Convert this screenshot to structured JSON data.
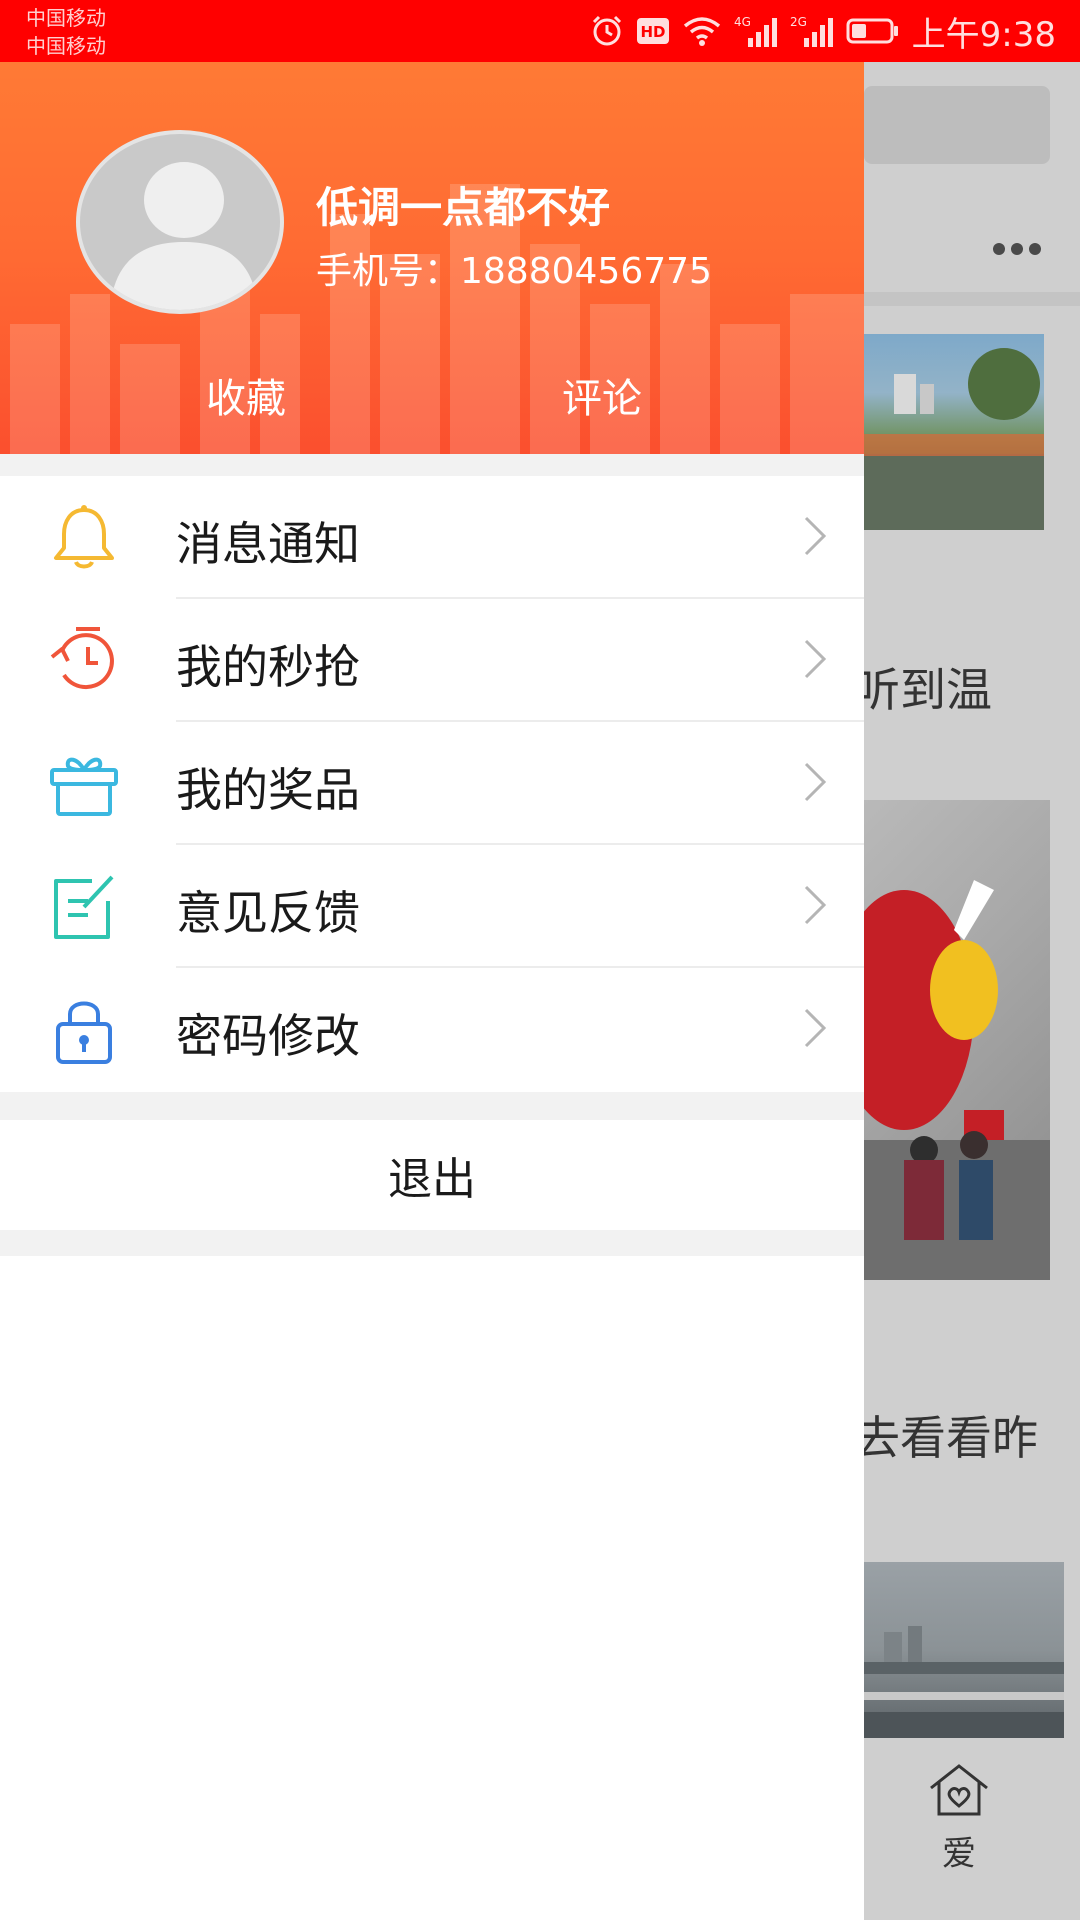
{
  "status_bar": {
    "carrier_1": "中国移动",
    "carrier_2": "中国移动",
    "time": "上午9:38",
    "network_1": "4G",
    "network_2": "2G",
    "hd_badge": "HD",
    "icons": [
      "alarm-icon",
      "hd-icon",
      "wifi-icon",
      "signal-icon",
      "signal-icon",
      "battery-icon"
    ]
  },
  "drawer": {
    "user": {
      "name": "低调一点都不好",
      "phone": "手机号：18880456775"
    },
    "header_links": [
      {
        "label": "收藏"
      },
      {
        "label": "评论"
      }
    ],
    "menu": [
      {
        "label": "消息通知",
        "icon": "bell-icon",
        "color": "#f5b932"
      },
      {
        "label": "我的秒抢",
        "icon": "timer-icon",
        "color": "#f0553a"
      },
      {
        "label": "我的奖品",
        "icon": "gift-icon",
        "color": "#3bb8e0"
      },
      {
        "label": "意见反馈",
        "icon": "feedback-icon",
        "color": "#2ec4b0"
      },
      {
        "label": "密码修改",
        "icon": "lock-icon",
        "color": "#3a7fe0"
      }
    ],
    "logout_label": "退出"
  },
  "background": {
    "text_1": "听到温",
    "text_2": "去看看昨",
    "tab_label": "爱"
  },
  "colors": {
    "status_bar": "#ff0000",
    "header_gradient_top": "#ff7a35",
    "header_gradient_bottom": "#fb4f2e"
  }
}
